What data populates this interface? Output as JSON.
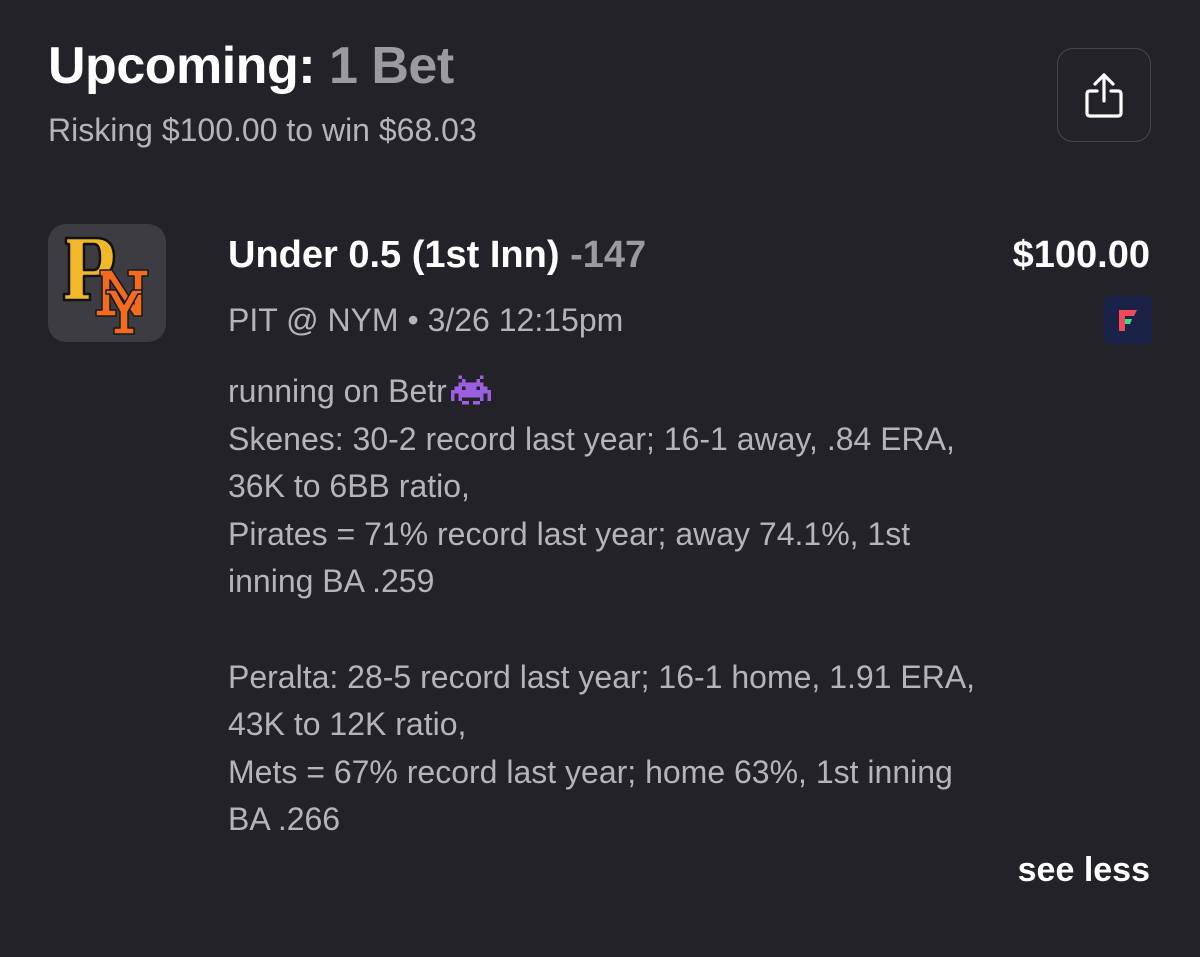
{
  "header": {
    "title_label": "Upcoming:",
    "title_count": "1 Bet",
    "subtitle": "Risking $100.00 to win $68.03"
  },
  "share_button": {
    "icon": "share-icon"
  },
  "bet": {
    "logo_icon": "pirates-mets-logo",
    "title": "Under 0.5 (1st Inn)",
    "odds": "-147",
    "amount": "$100.00",
    "matchup": "PIT @ NYM • 3/26 12:15pm",
    "sportsbook_icon": "fliff-icon",
    "notes_intro": "running on Betr",
    "notes_emoji": "space-invader-icon",
    "notes_lines": [
      "Skenes: 30-2 record last year; 16-1 away, .84 ERA,",
      "36K to 6BB ratio,",
      "Pirates = 71% record last year; away 74.1%, 1st",
      "inning BA .259",
      "",
      "Peralta: 28-5 record last year; 16-1 home, 1.91 ERA,",
      "43K to 12K ratio,",
      "Mets = 67% record last year; home 63%, 1st inning",
      "BA .266"
    ],
    "see_less_label": "see less"
  },
  "colors": {
    "background": "#222228",
    "primary_text": "#ffffff",
    "secondary_text": "#b4b4ba",
    "pirates_gold": "#f1b929",
    "mets_orange": "#f26b21"
  }
}
